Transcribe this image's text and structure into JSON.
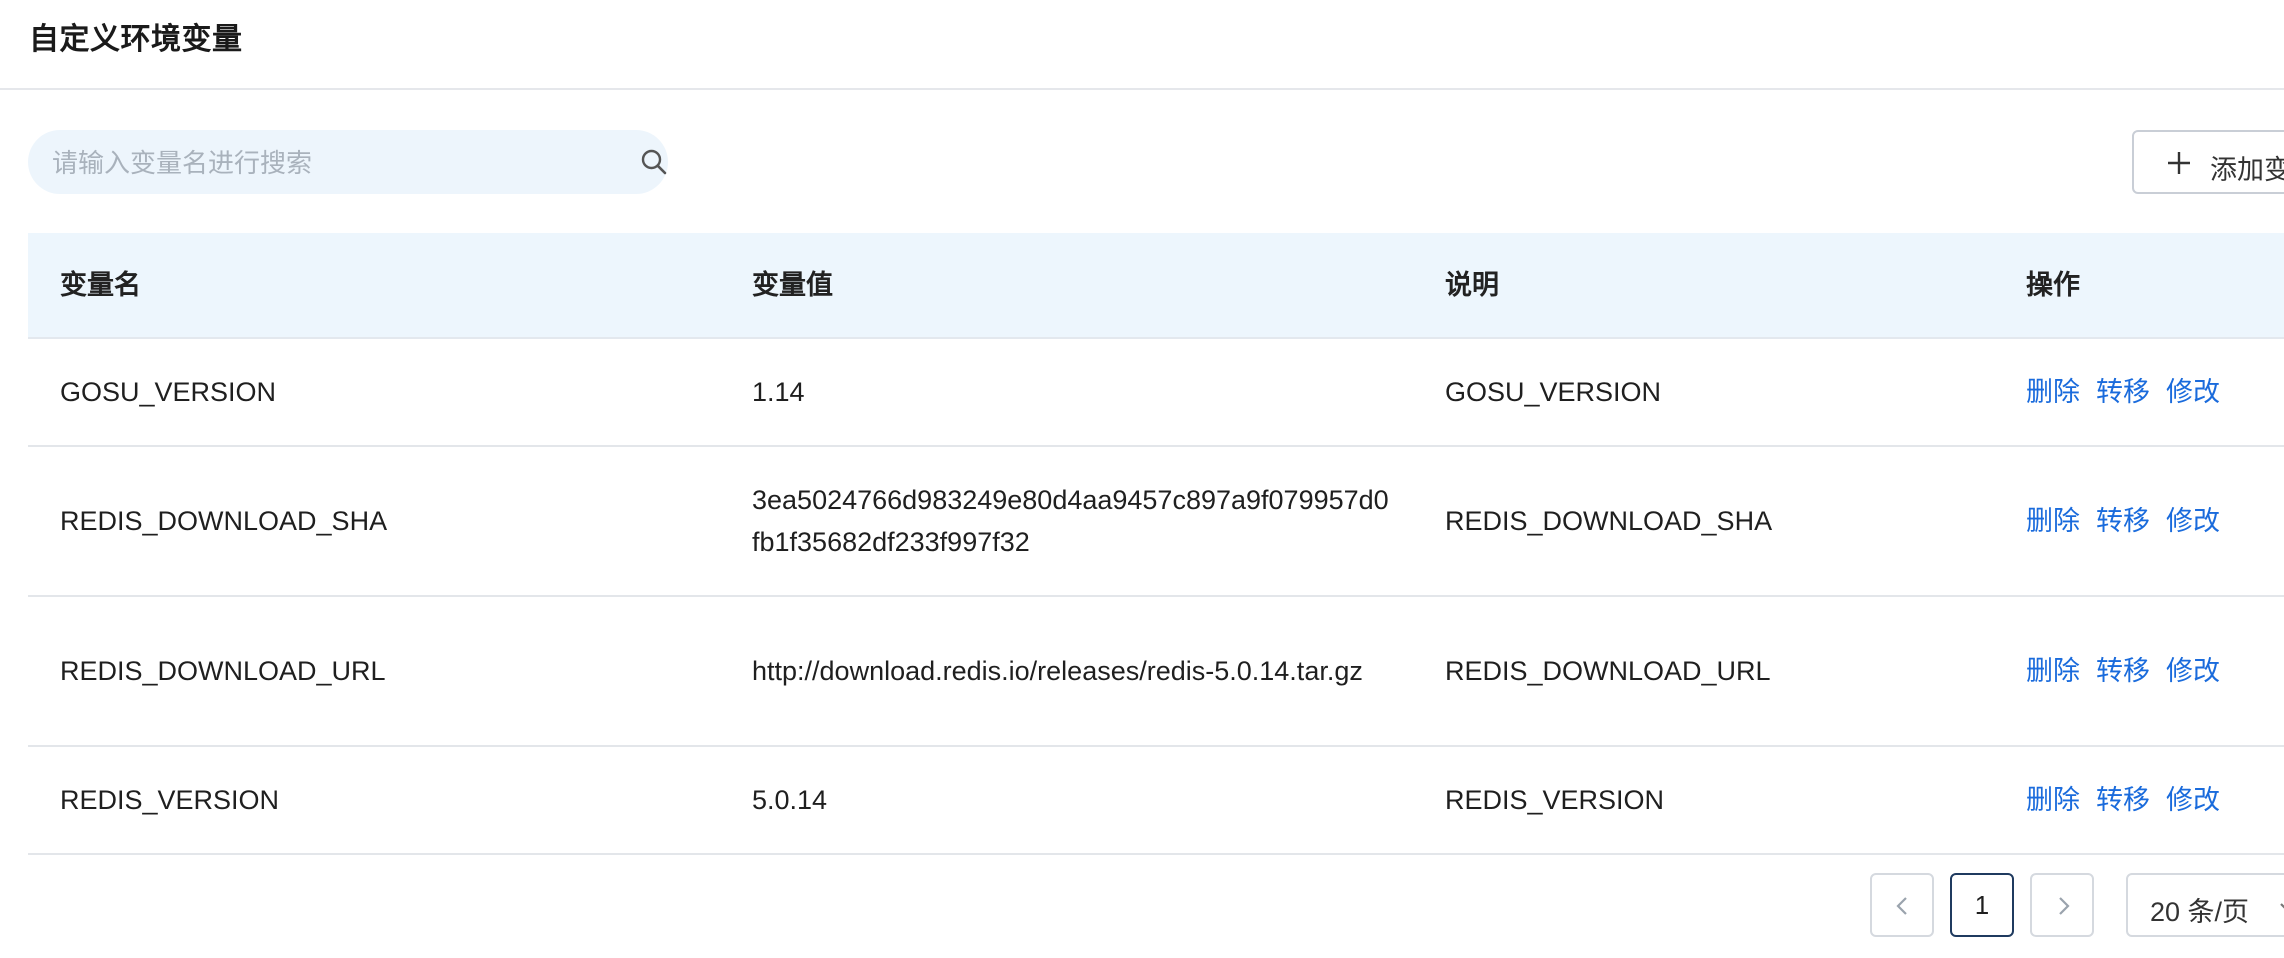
{
  "header": {
    "title": "自定义环境变量"
  },
  "search": {
    "placeholder": "请输入变量名进行搜索",
    "value": "",
    "icon": "search-icon"
  },
  "toolbar": {
    "add_label": "添加变",
    "add_icon": "plus-icon"
  },
  "table": {
    "columns": [
      "变量名",
      "变量值",
      "说明",
      "操作"
    ],
    "rows": [
      {
        "name": "GOSU_VERSION",
        "value": "1.14",
        "description": "GOSU_VERSION"
      },
      {
        "name": "REDIS_DOWNLOAD_SHA",
        "value": "3ea5024766d983249e80d4aa9457c897a9f079957d0fb1f35682df233f997f32",
        "description": "REDIS_DOWNLOAD_SHA"
      },
      {
        "name": "REDIS_DOWNLOAD_URL",
        "value": "http://download.redis.io/releases/redis-5.0.14.tar.gz",
        "description": "REDIS_DOWNLOAD_URL"
      },
      {
        "name": "REDIS_VERSION",
        "value": "5.0.14",
        "description": "REDIS_VERSION"
      }
    ],
    "actions": {
      "delete": "删除",
      "transfer": "转移",
      "edit": "修改"
    }
  },
  "pagination": {
    "current_page": "1",
    "page_size_label": "20 条/页",
    "prev_icon": "chevron-left-icon",
    "next_icon": "chevron-right-icon"
  },
  "colors": {
    "accent": "#1a6bdc",
    "header_bg": "#edf6fd",
    "search_bg": "#edf5fc",
    "border": "#e3e6ea"
  }
}
